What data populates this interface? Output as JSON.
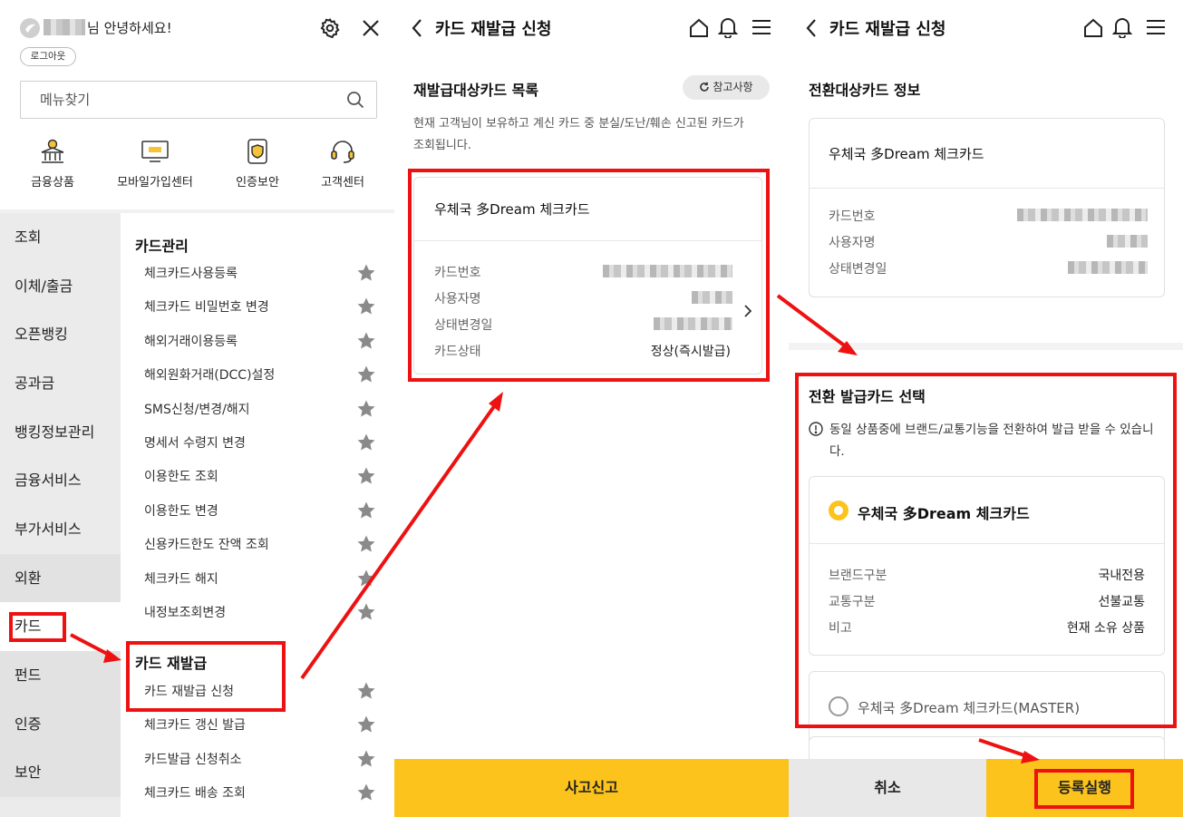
{
  "panel1": {
    "greeting": "님 안녕하세요!",
    "logout": "로그아웃",
    "search_placeholder": "메뉴찾기",
    "quick_menu": [
      {
        "label": "금융상품",
        "icon": "bank-building-icon"
      },
      {
        "label": "모바일가입센터",
        "icon": "monitor-icon"
      },
      {
        "label": "인증보안",
        "icon": "shield-icon"
      },
      {
        "label": "고객센터",
        "icon": "headset-icon"
      }
    ],
    "left_nav": [
      "조회",
      "이체/출금",
      "오픈뱅킹",
      "공과금",
      "뱅킹정보관리",
      "금융서비스",
      "부가서비스",
      "외환",
      "카드",
      "펀드",
      "인증",
      "보안"
    ],
    "active_nav": "카드",
    "sections": [
      {
        "title": "카드관리",
        "items": [
          "체크카드사용등록",
          "체크카드 비밀번호 변경",
          "해외거래이용등록",
          "해외원화거래(DCC)설정",
          "SMS신청/변경/해지",
          "명세서 수령지 변경",
          "이용한도 조회",
          "이용한도 변경",
          "신용카드한도 잔액 조회",
          "체크카드 해지",
          "내정보조회변경"
        ]
      },
      {
        "title": "카드 재발급",
        "items": [
          "카드 재발급 신청",
          "체크카드 갱신 발급",
          "카드발급 신청취소",
          "체크카드 배송 조회"
        ]
      }
    ]
  },
  "panel2": {
    "title": "카드 재발급 신청",
    "section_title": "재발급대상카드 목록",
    "ref_button": "참고사항",
    "description": "현재 고객님이 보유하고 계신 카드 중 분실/도난/훼손 신고된 카드가 조회됩니다.",
    "card": {
      "name": "우체국 多Dream 체크카드",
      "labels": [
        "카드번호",
        "사용자명",
        "상태변경일",
        "카드상태"
      ],
      "status": "정상(즉시발급)"
    },
    "bottom_button": "사고신고"
  },
  "panel3": {
    "title": "카드 재발급 신청",
    "info_title": "전환대상카드 정보",
    "card_name": "우체국 多Dream 체크카드",
    "labels": [
      "카드번호",
      "사용자명",
      "상태변경일"
    ],
    "select_title": "전환 발급카드 선택",
    "notice": "동일 상품중에 브랜드/교통기능을 전환하여 발급 받을 수 있습니다.",
    "option1": {
      "name": "우체국 多Dream 체크카드",
      "rows": [
        {
          "label": "브랜드구분",
          "value": "국내전용"
        },
        {
          "label": "교통구분",
          "value": "선불교통"
        },
        {
          "label": "비고",
          "value": "현재 소유 상품"
        }
      ]
    },
    "option2": {
      "name": "우체국 多Dream 체크카드(MASTER)"
    },
    "cancel_button": "취소",
    "submit_button": "등록실행"
  },
  "colors": {
    "accent": "#fbc31c",
    "annotation": "#ee1111",
    "nav_bg": "#ebebeb"
  }
}
